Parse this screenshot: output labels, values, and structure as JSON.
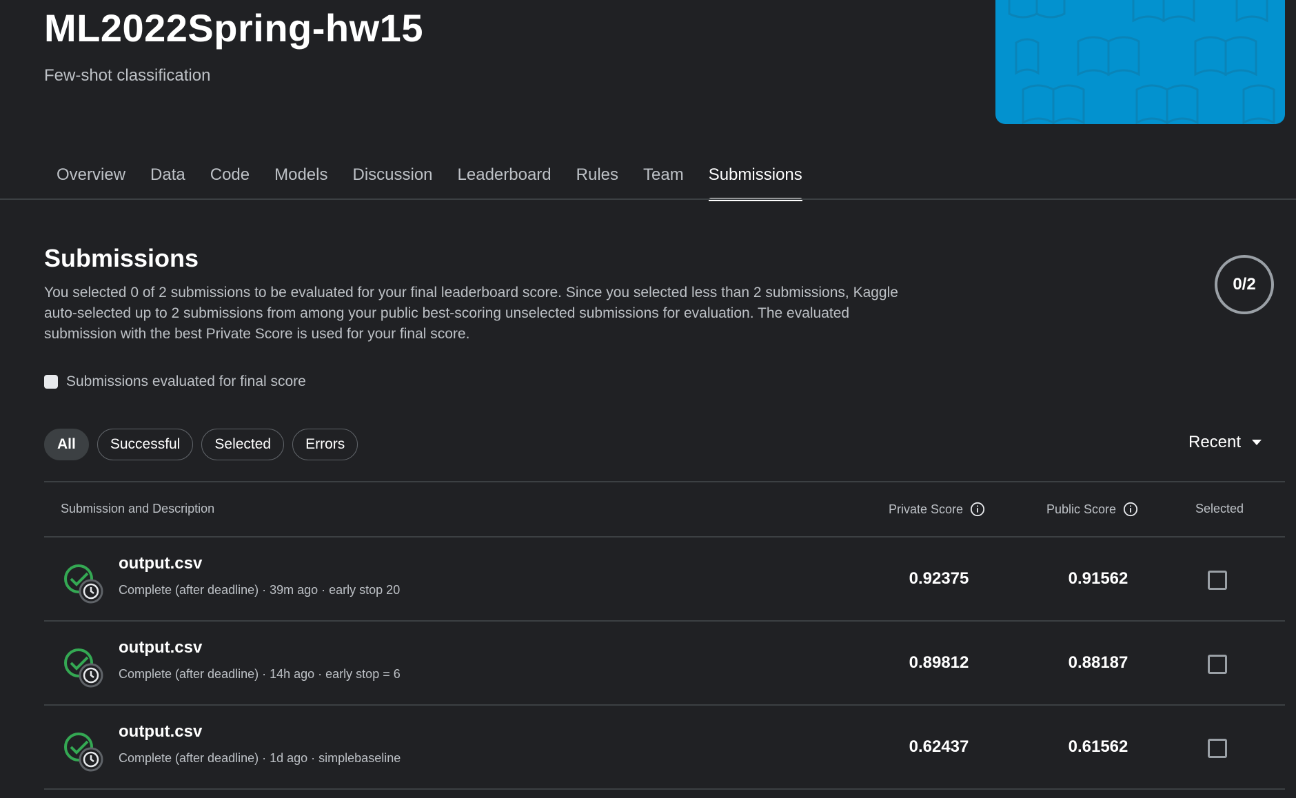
{
  "header": {
    "title": "ML2022Spring-hw15",
    "subtitle": "Few-shot classification",
    "banner_color": "#0392cf"
  },
  "tabs": [
    {
      "label": "Overview"
    },
    {
      "label": "Data"
    },
    {
      "label": "Code"
    },
    {
      "label": "Models"
    },
    {
      "label": "Discussion"
    },
    {
      "label": "Leaderboard"
    },
    {
      "label": "Rules"
    },
    {
      "label": "Team"
    },
    {
      "label": "Submissions",
      "active": true
    }
  ],
  "submissions": {
    "title": "Submissions",
    "description": "You selected 0 of 2 submissions to be evaluated for your final leaderboard score. Since you selected less than 2 submissions, Kaggle auto-selected up to 2 submissions from among your public best-scoring unselected submissions for evaluation. The evaluated submission with the best Private Score is used for your final score.",
    "selected_count": "0/2",
    "filter_label": "Submissions evaluated for final score"
  },
  "chips": [
    {
      "label": "All",
      "active": true
    },
    {
      "label": "Successful"
    },
    {
      "label": "Selected"
    },
    {
      "label": "Errors"
    }
  ],
  "sort": {
    "label": "Recent",
    "icon": "caret-down-icon"
  },
  "table": {
    "headers": {
      "submission": "Submission and Description",
      "private": "Private Score",
      "public": "Public Score",
      "selected": "Selected"
    },
    "rows": [
      {
        "file": "output.csv",
        "meta": "Complete (after deadline) · 39m ago · early stop 20",
        "private": "0.92375",
        "public": "0.91562",
        "selected": false
      },
      {
        "file": "output.csv",
        "meta": "Complete (after deadline) · 14h ago · early stop = 6",
        "private": "0.89812",
        "public": "0.88187",
        "selected": false
      },
      {
        "file": "output.csv",
        "meta": "Complete (after deadline) · 1d ago · simplebaseline",
        "private": "0.62437",
        "public": "0.61562",
        "selected": false
      }
    ]
  },
  "colors": {
    "success": "#34a853",
    "background": "#202124"
  }
}
